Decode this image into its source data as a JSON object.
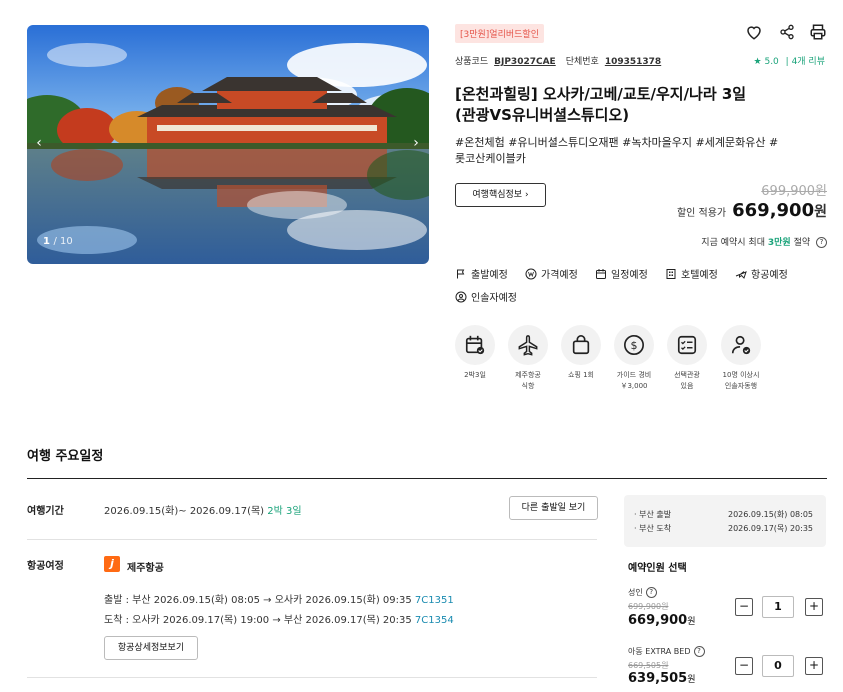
{
  "hero": {
    "counter_current": "1",
    "counter_total": "/ 10"
  },
  "product": {
    "tag": "[3만원]얼리버드할인",
    "code_label": "상품코드",
    "code": "BJP3027CAE",
    "group_label": "단체번호",
    "group_no": "109351378",
    "rating": "5.0",
    "reviews": "| 4개 리뷰",
    "title_line1": "[온천과힐링] 오사카/고베/교토/우지/나라 3일",
    "title_line2": "(관광VS유니버셜스튜디오)",
    "hashtags_line1": "#온천체험 #유니버셜스튜디오재팬 #녹차마을우지 #세계문화유산 #",
    "hashtags_line2": "롯코산케이블카",
    "info_button": "여행핵심정보",
    "original_price": "699,900원",
    "sale_label": "할인 적용가",
    "sale_price": "669,900",
    "won": "원",
    "booking_pre": "지금 예약시 최대",
    "booking_amount": "3만원",
    "booking_post": "절약"
  },
  "nav": [
    {
      "label": "출발예정",
      "icon": "flag-icon"
    },
    {
      "label": "가격예정",
      "icon": "won-icon"
    },
    {
      "label": "일정예정",
      "icon": "calendar-icon"
    },
    {
      "label": "호텔예정",
      "icon": "building-icon"
    },
    {
      "label": "항공예정",
      "icon": "plane-icon"
    }
  ],
  "nav2": {
    "label": "인솔자예정",
    "icon": "person-icon"
  },
  "features": [
    {
      "l1": "2박3일",
      "l2": "",
      "icon": "calendar-check-icon"
    },
    {
      "l1": "제주항공",
      "l2": "식항",
      "icon": "plane-icon"
    },
    {
      "l1": "쇼핑 1회",
      "l2": "",
      "icon": "shopping-bag-icon"
    },
    {
      "l1": "가이드 경비",
      "l2": "￥3,000",
      "icon": "dollar-icon"
    },
    {
      "l1": "선택관광",
      "l2": "있음",
      "icon": "checklist-icon"
    },
    {
      "l1": "10명 이상시",
      "l2": "인솔자동행",
      "icon": "person-check-icon"
    }
  ],
  "itinerary": {
    "section_title": "여행 주요일정",
    "period_label": "여행기간",
    "period_value": "2026.09.15(화)~ 2026.09.17(목)",
    "period_nights": "2박 3일",
    "other_dates_button": "다른 출발일 보기",
    "flight_label": "항공여정",
    "airline": "제주항공",
    "dep_text": "출발 : 부산 2026.09.15(화) 08:05 → 오사카 2026.09.15(화) 09:35",
    "dep_code": "7C1351",
    "arr_text": "도착 : 오사카 2026.09.17(목) 19:00 → 부산 2026.09.17(목) 20:35",
    "arr_code": "7C1354",
    "flight_detail_button": "항공상세정보보기"
  },
  "sidebar": {
    "dep_label": "· 부산 출발",
    "dep_value": "2026.09.15(화) 08:05",
    "arr_label": "· 부산 도착",
    "arr_value": "2026.09.17(목) 20:35",
    "pick_title": "예약인원 선택",
    "adult_label": "성인",
    "adult_orig": "699,900원",
    "adult_price": "669,900",
    "adult_won": "원",
    "adult_qty": "1",
    "child_label": "아동 EXTRA BED",
    "child_orig": "669,505원",
    "child_price": "639,505",
    "child_won": "원",
    "child_qty": "0"
  }
}
